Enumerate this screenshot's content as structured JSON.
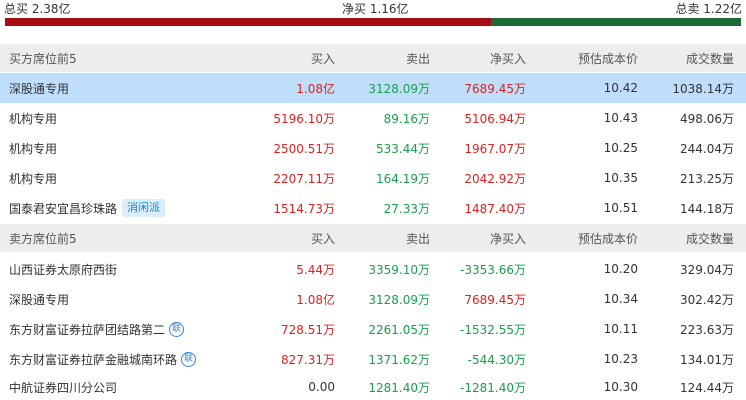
{
  "summary": {
    "total_buy": "总买 2.38亿",
    "net_buy": "净买 1.16亿",
    "total_sell": "总卖 1.22亿"
  },
  "colors": {
    "buy_bar": "#a50f13",
    "sell_bar": "#1e6a36",
    "up": "#e02020",
    "down": "#17a14b",
    "highlight_row": "#bfdefb",
    "header_bg": "#ededed",
    "tag_bg": "#dbeefe",
    "tag_text": "#1a85e0"
  },
  "buyers": {
    "header": {
      "name": "买方席位前5",
      "buy": "买入",
      "sell": "卖出",
      "net": "净买入",
      "cost": "预估成本价",
      "volume": "成交数量"
    },
    "rows": [
      {
        "name": "深股通专用",
        "buy": "1.08亿",
        "sell": "3128.09万",
        "net": "7689.45万",
        "cost": "10.42",
        "volume": "1038.14万"
      },
      {
        "name": "机构专用",
        "buy": "5196.10万",
        "sell": "89.16万",
        "net": "5106.94万",
        "cost": "10.43",
        "volume": "498.06万"
      },
      {
        "name": "机构专用",
        "buy": "2500.51万",
        "sell": "533.44万",
        "net": "1967.07万",
        "cost": "10.25",
        "volume": "244.04万"
      },
      {
        "name": "机构专用",
        "buy": "2207.11万",
        "sell": "164.19万",
        "net": "2042.92万",
        "cost": "10.35",
        "volume": "213.25万"
      },
      {
        "name": "国泰君安宜昌珍珠路",
        "tag": "消闲派",
        "buy": "1514.73万",
        "sell": "27.33万",
        "net": "1487.40万",
        "cost": "10.51",
        "volume": "144.18万"
      }
    ]
  },
  "sellers": {
    "header": {
      "name": "卖方席位前5",
      "buy": "买入",
      "sell": "卖出",
      "net": "净买入",
      "cost": "预估成本价",
      "volume": "成交数量"
    },
    "rows": [
      {
        "name": "山西证券太原府西街",
        "buy": "5.44万",
        "sell": "3359.10万",
        "net": "-3353.66万",
        "cost": "10.20",
        "volume": "329.04万"
      },
      {
        "name": "深股通专用",
        "buy": "1.08亿",
        "sell": "3128.09万",
        "net": "7689.45万",
        "cost": "10.34",
        "volume": "302.42万"
      },
      {
        "name": "东方财富证券拉萨团结路第二",
        "badge": "联",
        "buy": "728.51万",
        "sell": "2261.05万",
        "net": "-1532.55万",
        "cost": "10.11",
        "volume": "223.63万"
      },
      {
        "name": "东方财富证券拉萨金融城南环路",
        "badge": "联",
        "buy": "827.31万",
        "sell": "1371.62万",
        "net": "-544.30万",
        "cost": "10.23",
        "volume": "134.01万"
      },
      {
        "name": "中航证券四川分公司",
        "buy": "0.00",
        "sell": "1281.40万",
        "net": "-1281.40万",
        "cost": "10.30",
        "volume": "124.44万"
      }
    ]
  }
}
